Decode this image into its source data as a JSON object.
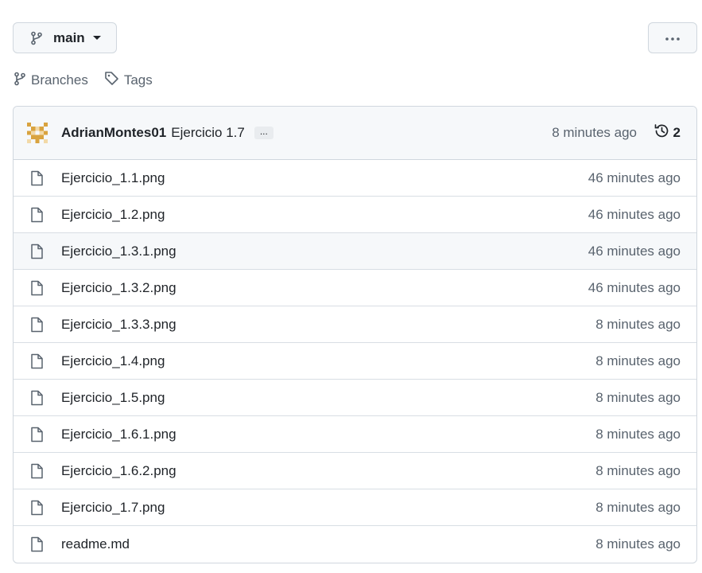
{
  "branch": {
    "name": "main",
    "icon": "git-branch-icon"
  },
  "more_button": {
    "icon": "kebab-horizontal-icon"
  },
  "links": [
    {
      "label": "Branches",
      "icon": "git-branch-icon"
    },
    {
      "label": "Tags",
      "icon": "tag-icon"
    }
  ],
  "commit": {
    "author": "AdrianMontes01",
    "message": "Ejercicio 1.7",
    "ellipsis": "...",
    "time": "8 minutes ago",
    "history_count": "2"
  },
  "files": [
    {
      "name": "Ejercicio_1.1.png",
      "time": "46 minutes ago"
    },
    {
      "name": "Ejercicio_1.2.png",
      "time": "46 minutes ago"
    },
    {
      "name": "Ejercicio_1.3.1.png",
      "time": "46 minutes ago"
    },
    {
      "name": "Ejercicio_1.3.2.png",
      "time": "46 minutes ago"
    },
    {
      "name": "Ejercicio_1.3.3.png",
      "time": "8 minutes ago"
    },
    {
      "name": "Ejercicio_1.4.png",
      "time": "8 minutes ago"
    },
    {
      "name": "Ejercicio_1.5.png",
      "time": "8 minutes ago"
    },
    {
      "name": "Ejercicio_1.6.1.png",
      "time": "8 minutes ago"
    },
    {
      "name": "Ejercicio_1.6.2.png",
      "time": "8 minutes ago"
    },
    {
      "name": "Ejercicio_1.7.png",
      "time": "8 minutes ago"
    },
    {
      "name": "readme.md",
      "time": "8 minutes ago"
    }
  ],
  "colors": {
    "border": "#d0d7de",
    "muted": "#59636e",
    "header_bg": "#f6f8fa",
    "avatar": "#d9a33f"
  }
}
